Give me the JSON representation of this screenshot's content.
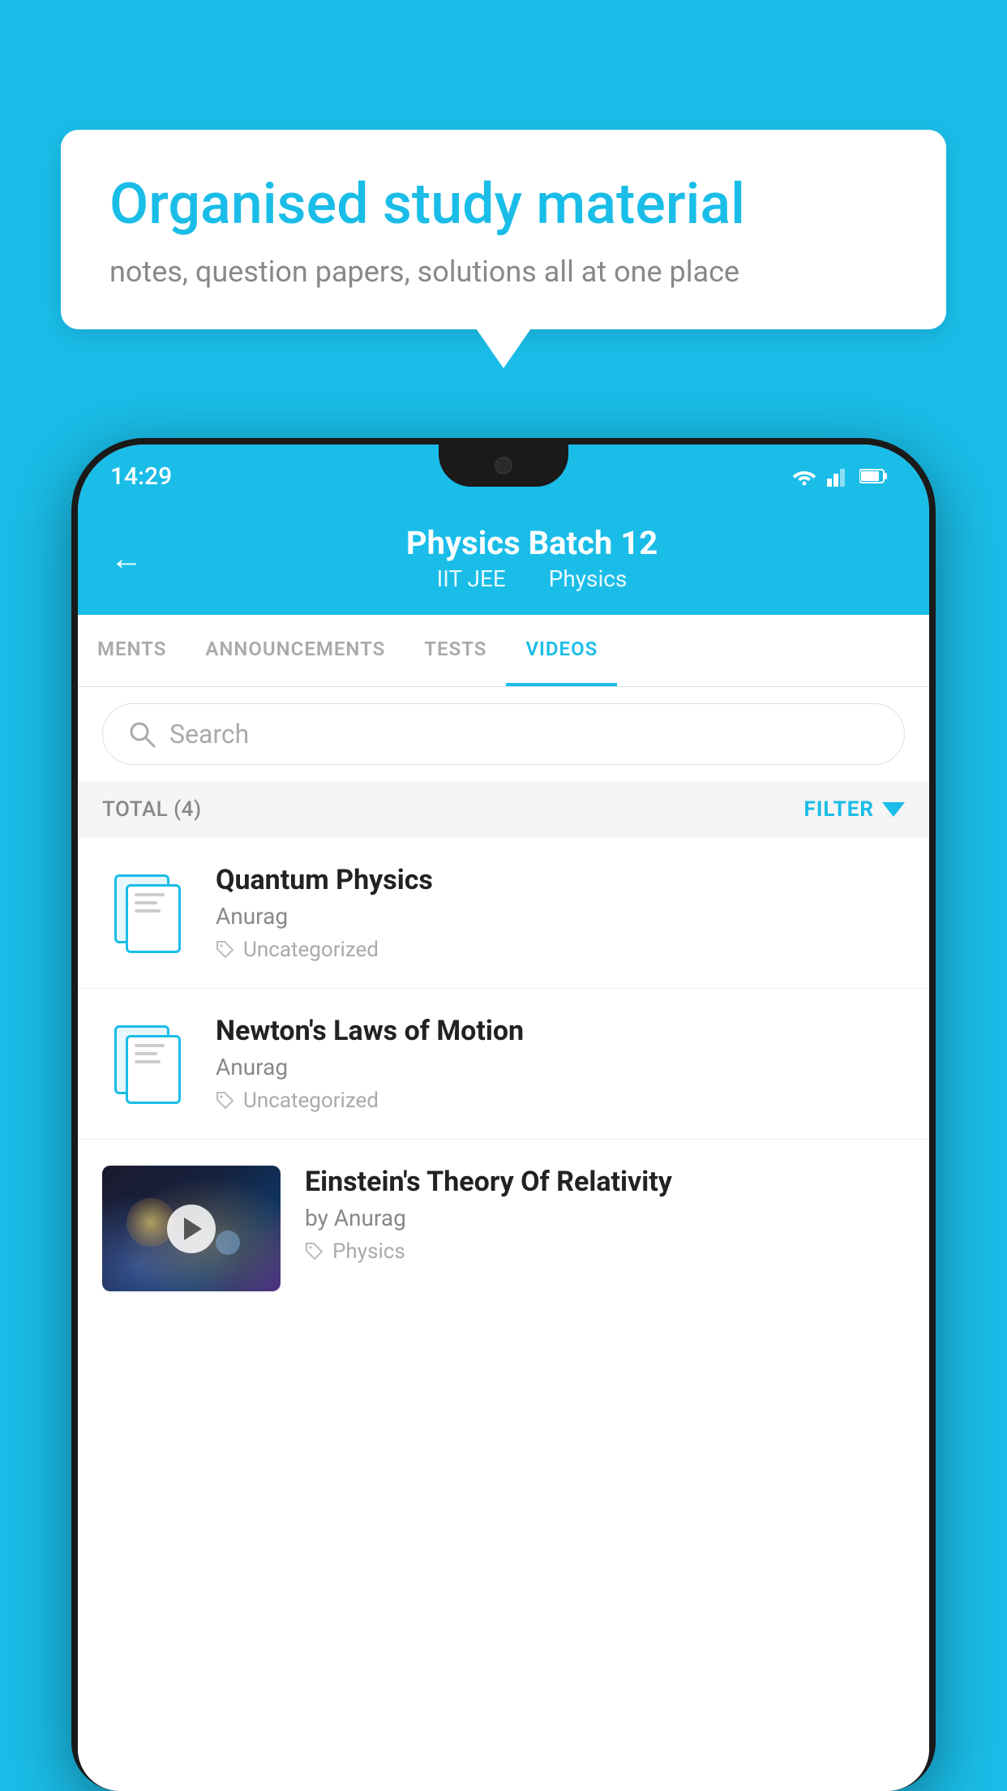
{
  "background_color": "#1ABDE8",
  "bubble": {
    "title": "Organised study material",
    "subtitle": "notes, question papers, solutions all at one place"
  },
  "status_bar": {
    "time": "14:29",
    "icons": [
      "wifi",
      "signal",
      "battery"
    ]
  },
  "header": {
    "title": "Physics Batch 12",
    "subtitle_part1": "IIT JEE",
    "subtitle_part2": "Physics",
    "back_label": "←"
  },
  "tabs": [
    {
      "label": "MENTS",
      "active": false
    },
    {
      "label": "ANNOUNCEMENTS",
      "active": false
    },
    {
      "label": "TESTS",
      "active": false
    },
    {
      "label": "VIDEOS",
      "active": true
    }
  ],
  "search": {
    "placeholder": "Search"
  },
  "filter": {
    "total_label": "TOTAL (4)",
    "filter_label": "FILTER"
  },
  "videos": [
    {
      "id": 1,
      "title": "Quantum Physics",
      "author": "Anurag",
      "tag": "Uncategorized",
      "has_thumbnail": false
    },
    {
      "id": 2,
      "title": "Newton's Laws of Motion",
      "author": "Anurag",
      "tag": "Uncategorized",
      "has_thumbnail": false
    },
    {
      "id": 3,
      "title": "Einstein's Theory Of Relativity",
      "author": "by Anurag",
      "tag": "Physics",
      "has_thumbnail": true
    }
  ]
}
